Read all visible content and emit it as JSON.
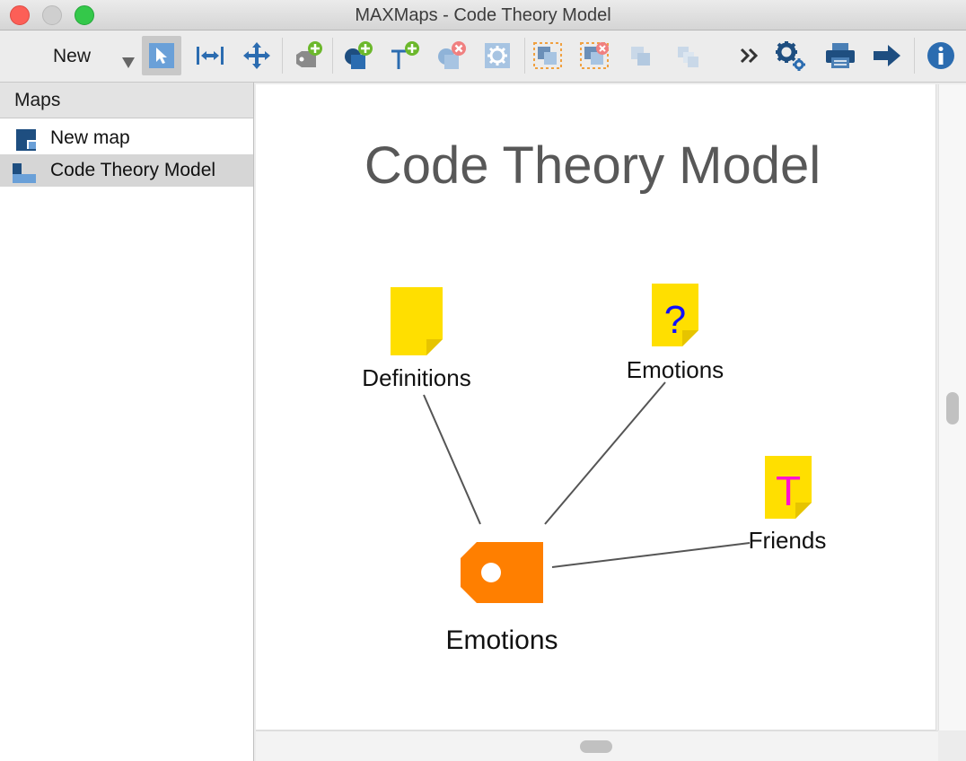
{
  "window": {
    "title": "MAXMaps - Code Theory Model"
  },
  "toolbar": {
    "new_label": "New",
    "buttons": [
      {
        "icon": "select-pointer-icon",
        "active": true
      },
      {
        "icon": "fit-width-icon"
      },
      {
        "icon": "move-icon"
      },
      {
        "icon": "add-code-icon"
      },
      {
        "icon": "add-shape-icon"
      },
      {
        "icon": "add-text-icon"
      },
      {
        "icon": "remove-shape-icon"
      },
      {
        "icon": "settings-icon"
      },
      {
        "icon": "group-icon"
      },
      {
        "icon": "ungroup-icon"
      },
      {
        "icon": "bring-front-icon"
      },
      {
        "icon": "send-back-icon"
      },
      {
        "icon": "more-chevron-icon"
      },
      {
        "icon": "gears-icon"
      },
      {
        "icon": "print-icon"
      },
      {
        "icon": "export-arrow-icon"
      },
      {
        "icon": "info-icon"
      }
    ]
  },
  "sidebar": {
    "header": "Maps",
    "items": [
      {
        "label": "New map",
        "selected": false
      },
      {
        "label": "Code Theory Model",
        "selected": true
      }
    ]
  },
  "map": {
    "title": "Code Theory Model",
    "nodes": {
      "definitions": {
        "label": "Definitions",
        "memo_glyph": ""
      },
      "emotions_memo": {
        "label": "Emotions",
        "memo_glyph": "?"
      },
      "friends": {
        "label": "Friends",
        "memo_glyph": "T"
      },
      "emotions_code": {
        "label": "Emotions"
      }
    }
  },
  "colors": {
    "memo_yellow": "#ffdf00",
    "code_orange": "#ff7f00",
    "icon_blue": "#2b6cb0",
    "plus_green": "#6cb82c",
    "remove_red": "#f08080"
  }
}
